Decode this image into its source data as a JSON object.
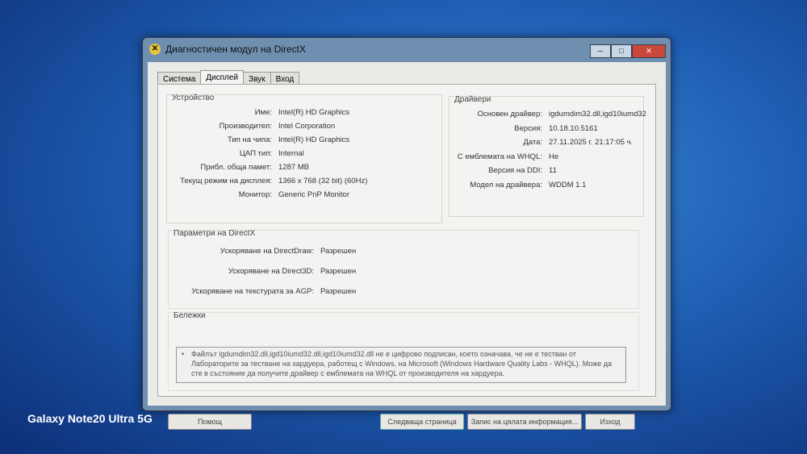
{
  "window": {
    "title": "Диагностичен модул на DirectX"
  },
  "tabs": [
    "Система",
    "Дисплей",
    "Звук",
    "Вход"
  ],
  "device": {
    "heading": "Устройство",
    "rows": [
      {
        "k": "Име:",
        "v": "Intel(R) HD Graphics"
      },
      {
        "k": "Производител:",
        "v": "Intel Corporation"
      },
      {
        "k": "Тип на чипа:",
        "v": "Intel(R) HD Graphics"
      },
      {
        "k": "ЦАП тип:",
        "v": "Internal"
      },
      {
        "k": "Прибл. обща памет:",
        "v": "1287 MB"
      },
      {
        "k": "Текущ режим на дисплея:",
        "v": "1366 x 768 (32 bit) (60Hz)"
      },
      {
        "k": "Монитор:",
        "v": "Generic PnP Monitor"
      }
    ]
  },
  "drivers": {
    "heading": "Драйвери",
    "rows": [
      {
        "k": "Основен драйвер:",
        "v": "igdumdim32.dll,igd10iumd32"
      },
      {
        "k": "Версия:",
        "v": "10.18.10.5161"
      },
      {
        "k": "Дата:",
        "v": "27.11.2025 г. 21:17:05 ч."
      },
      {
        "k": "С емблемата на WHQL:",
        "v": "Не"
      },
      {
        "k": "Версия на DDI:",
        "v": "11"
      },
      {
        "k": "Модел на драйвера:",
        "v": "WDDM 1.1"
      }
    ]
  },
  "directx": {
    "heading": "Параметри на DirectX",
    "rows": [
      {
        "k": "Ускоряване на DirectDraw:",
        "v": "Разрешен"
      },
      {
        "k": "Ускоряване на Direct3D:",
        "v": "Разрешен"
      },
      {
        "k": "Ускоряване на текстурата за AGP:",
        "v": "Разрешен"
      }
    ]
  },
  "notes": {
    "heading": "Бележки",
    "text": "Файлът igdumdim32.dll,igd10iumd32.dll,igd10iumd32.dll не е цифрово подписан, което означава, че не е тестван от Лабораторите за тестване на хардуера, работещ с Windows, на Microsoft (Windows Hardware Quality Labs - WHQL). Може да сте в състояние да получите драйвер с емблемата на WHQL от производителя на хардуера."
  },
  "buttons": {
    "help": "Помощ",
    "next": "Следваща страница",
    "save": "Запис на цялата информация...",
    "exit": "Изход"
  },
  "watermark": "Galaxy Note20 Ultra 5G"
}
